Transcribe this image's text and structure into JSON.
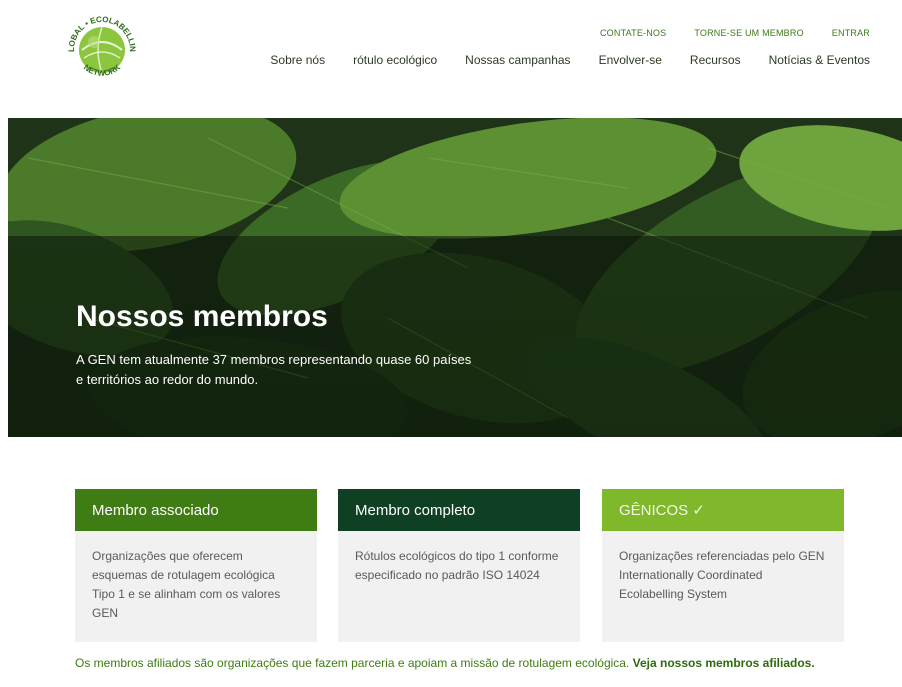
{
  "logo": {
    "ring_top": "ECOLABELLING",
    "ring_left": "GLOBAL",
    "ring_bottom": "NETWORK",
    "colors": {
      "green": "#8cc63f",
      "dark": "#2e6b1a"
    }
  },
  "util_nav": [
    {
      "label": "CONTATE-NOS"
    },
    {
      "label": "TORNE-SE UM MEMBRO"
    },
    {
      "label": "ENTRAR"
    }
  ],
  "main_nav": [
    {
      "label": "Sobre nós"
    },
    {
      "label": "rótulo ecológico"
    },
    {
      "label": "Nossas campanhas"
    },
    {
      "label": "Envolver-se"
    },
    {
      "label": "Recursos"
    },
    {
      "label": "Notícias & Eventos"
    }
  ],
  "hero": {
    "title": "Nossos membros",
    "text": "A GEN tem atualmente 37 membros representando quase 60 países e territórios ao redor do mundo."
  },
  "cards": [
    {
      "title": "Membro associado",
      "body": "Organizações que oferecem esquemas de rotulagem ecológica Tipo 1 e se alinham com os valores GEN",
      "color": "#3f7c13"
    },
    {
      "title": "Membro completo",
      "body": "Rótulos ecológicos do tipo 1 conforme especificado no padrão ISO 14024",
      "color": "#0f4024"
    },
    {
      "title": "GÊNICOS ✓",
      "body": "Organizações referenciadas pelo GEN Internationally Coordinated Ecolabelling System",
      "color": "#7fb82a"
    }
  ],
  "footnote": {
    "text": "Os membros afiliados são organizações que fazem parceria e apoiam a missão de rotulagem ecológica. ",
    "link": "Veja nossos membros afiliados."
  }
}
